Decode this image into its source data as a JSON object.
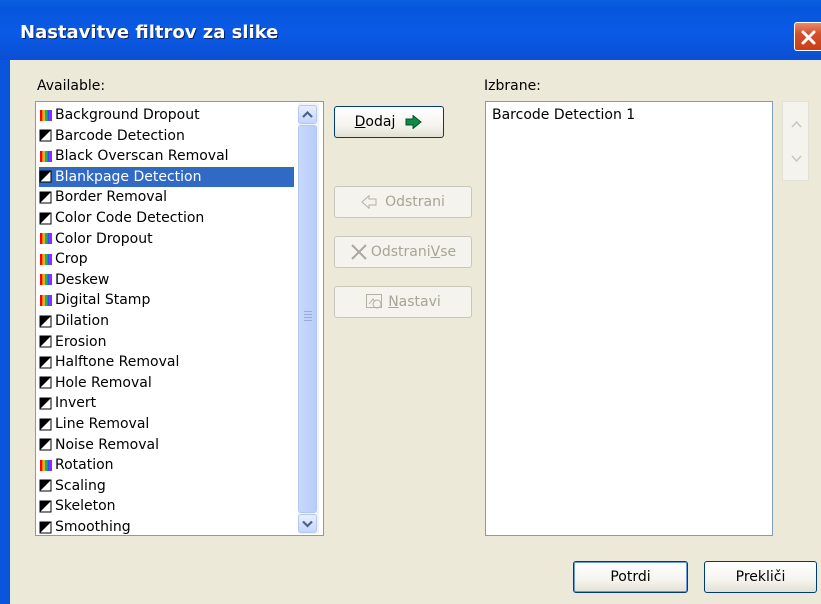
{
  "dialog": {
    "title": "Nastavitve filtrov za slike"
  },
  "available": {
    "label": "Available:",
    "selected_index": 3,
    "items": [
      {
        "label": "Background Dropout",
        "icon": "color-filter-icon"
      },
      {
        "label": "Barcode Detection",
        "icon": "bw-filter-icon"
      },
      {
        "label": "Black Overscan Removal",
        "icon": "color-filter-icon"
      },
      {
        "label": "Blankpage Detection",
        "icon": "bw-filter-icon"
      },
      {
        "label": "Border Removal",
        "icon": "bw-filter-icon"
      },
      {
        "label": "Color Code Detection",
        "icon": "bw-filter-icon"
      },
      {
        "label": "Color Dropout",
        "icon": "color-filter-icon"
      },
      {
        "label": "Crop",
        "icon": "color-filter-icon"
      },
      {
        "label": "Deskew",
        "icon": "color-filter-icon"
      },
      {
        "label": "Digital Stamp",
        "icon": "color-filter-icon"
      },
      {
        "label": "Dilation",
        "icon": "bw-filter-icon"
      },
      {
        "label": "Erosion",
        "icon": "bw-filter-icon"
      },
      {
        "label": "Halftone Removal",
        "icon": "bw-filter-icon"
      },
      {
        "label": "Hole Removal",
        "icon": "bw-filter-icon"
      },
      {
        "label": "Invert",
        "icon": "bw-filter-icon"
      },
      {
        "label": "Line Removal",
        "icon": "bw-filter-icon"
      },
      {
        "label": "Noise Removal",
        "icon": "bw-filter-icon"
      },
      {
        "label": "Rotation",
        "icon": "color-filter-icon"
      },
      {
        "label": "Scaling",
        "icon": "bw-filter-icon"
      },
      {
        "label": "Skeleton",
        "icon": "bw-filter-icon"
      },
      {
        "label": "Smoothing",
        "icon": "bw-filter-icon"
      }
    ]
  },
  "selected": {
    "label": "Izbrane:",
    "items": [
      {
        "label": "Barcode Detection 1"
      }
    ]
  },
  "buttons": {
    "add": {
      "label_u": "D",
      "label_rest": "odaj"
    },
    "remove": {
      "label": "Odstrani"
    },
    "remove_all": {
      "label_pre": "Odstrani ",
      "label_u": "V",
      "label_rest": "se"
    },
    "configure": {
      "label_u": "N",
      "label_rest": "astavi"
    },
    "ok": {
      "label": "Potrdi"
    },
    "cancel": {
      "label": "Prekliči"
    }
  },
  "colors": {
    "titlebar": "#0a5ae6",
    "selection": "#316ac5",
    "dialog_bg": "#ece9d8"
  }
}
